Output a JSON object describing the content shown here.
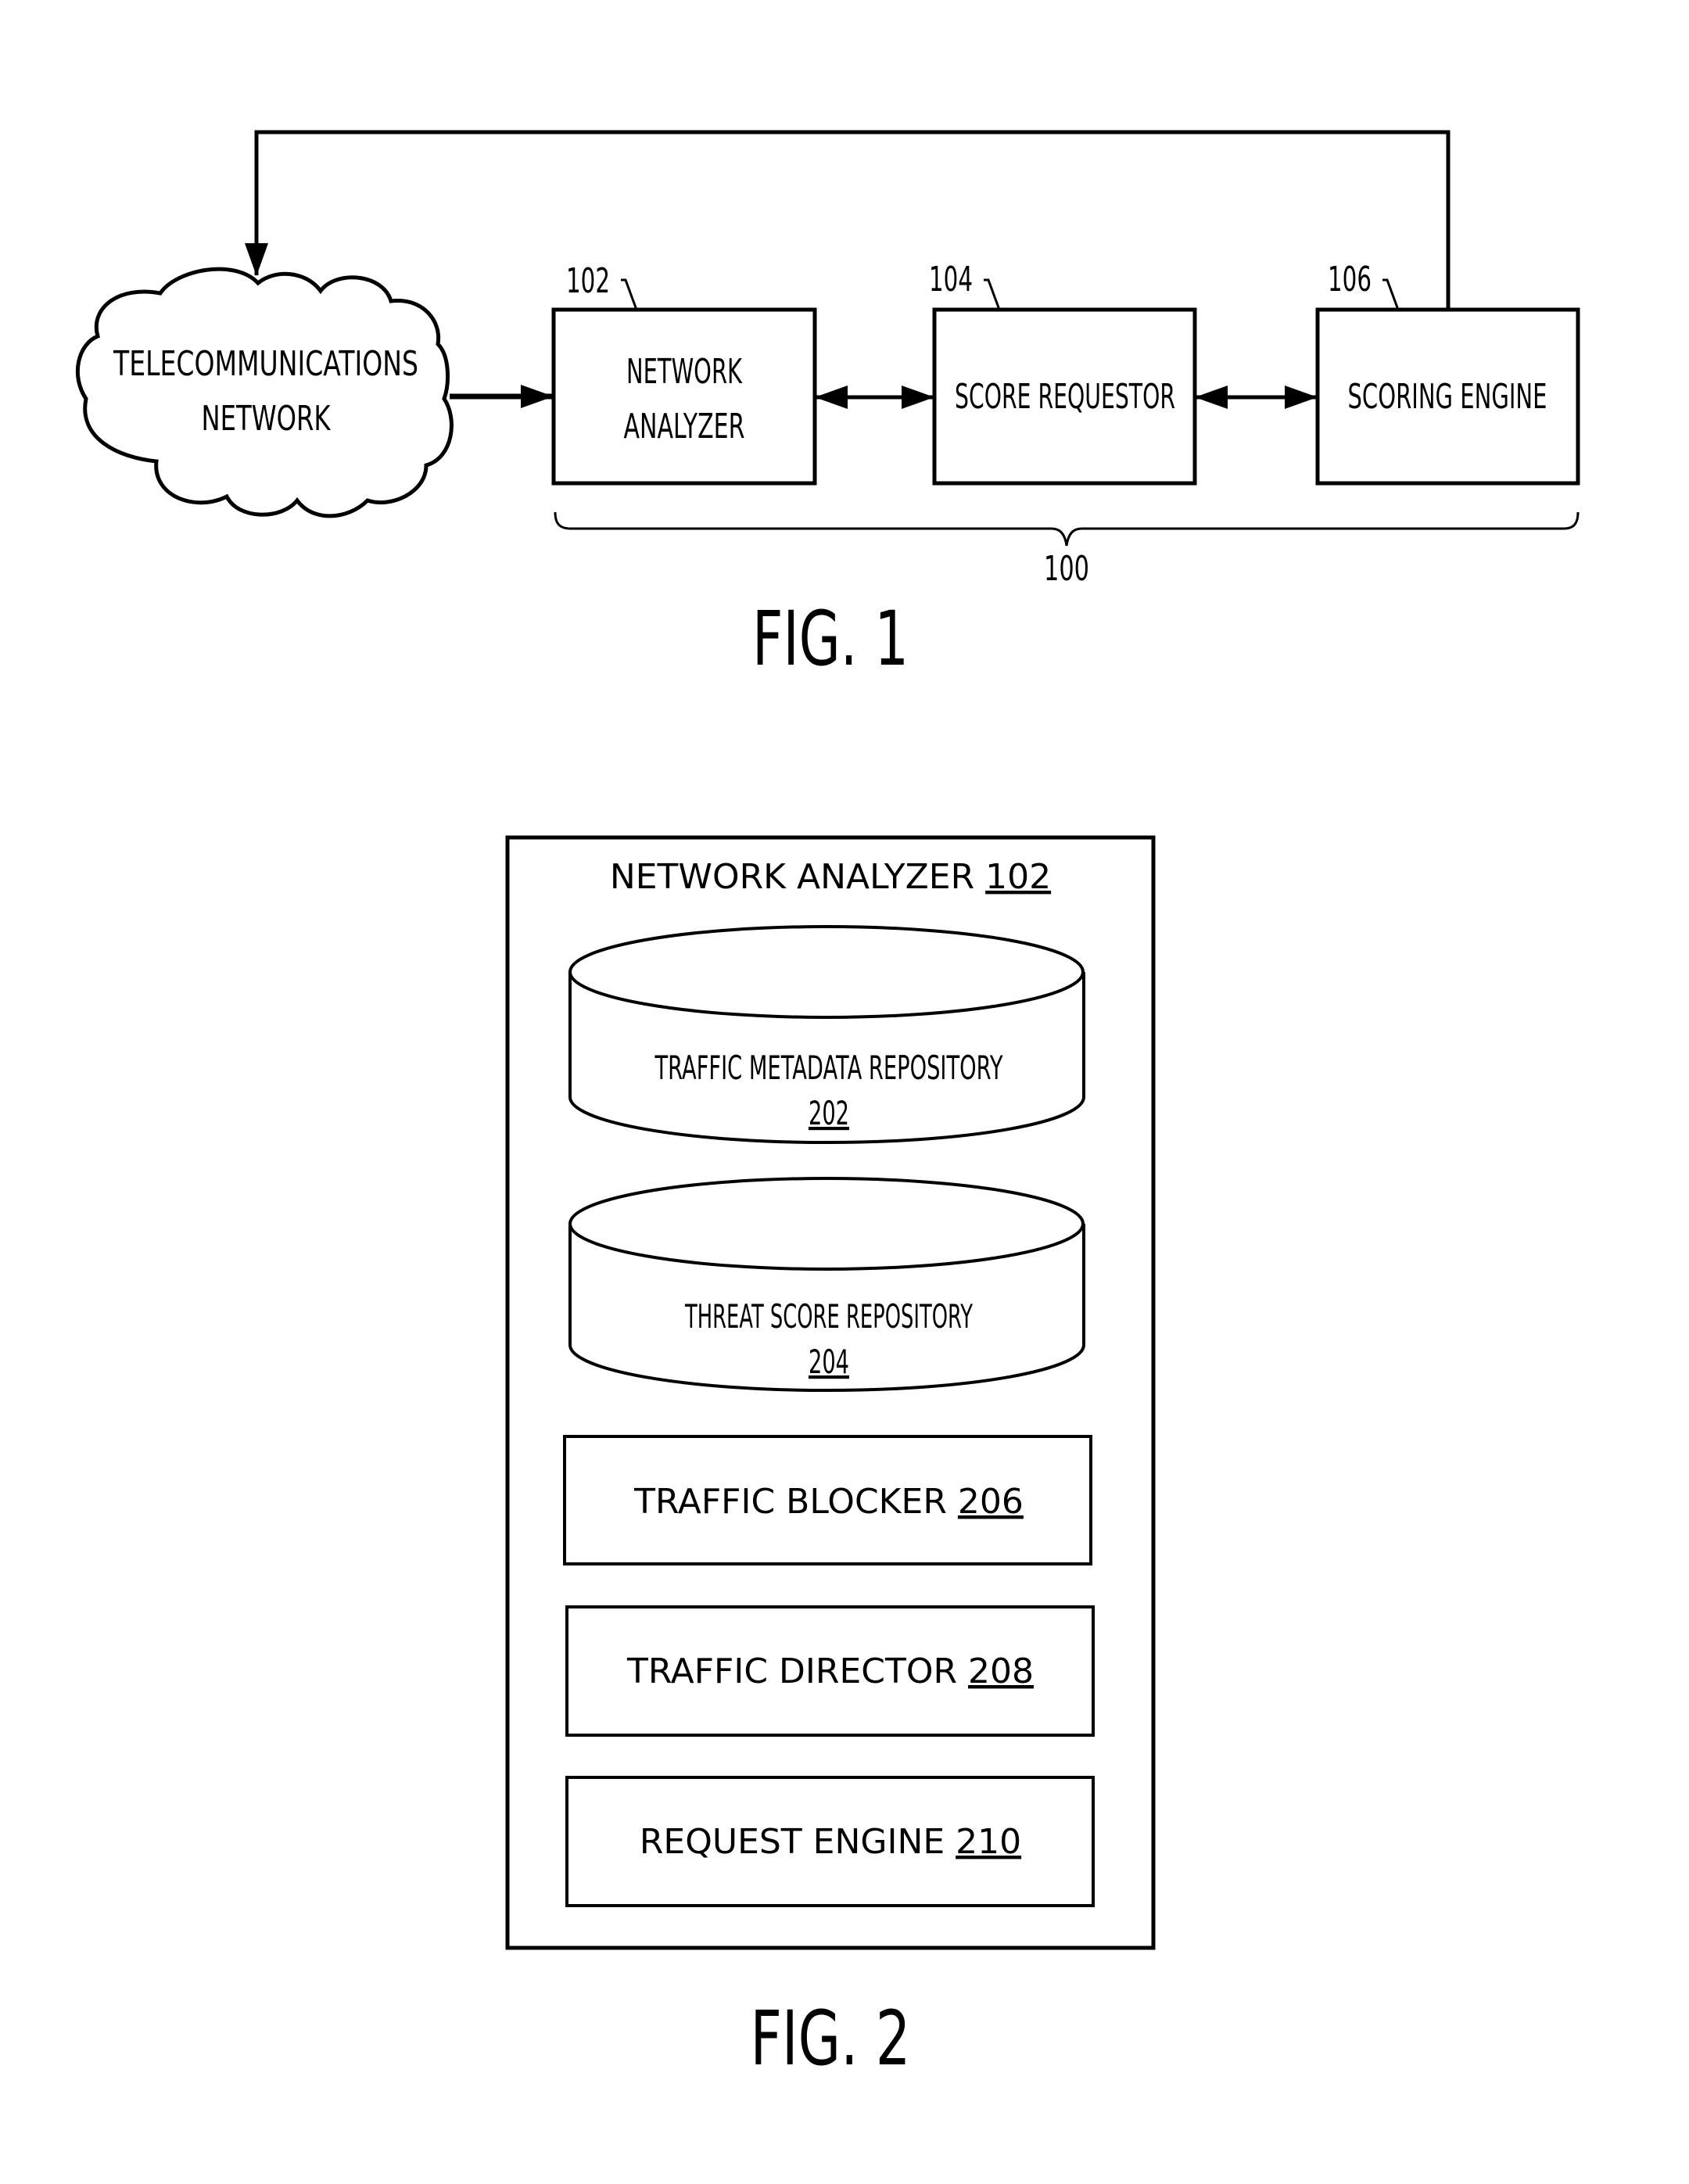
{
  "fig1": {
    "caption": "FIG. 1",
    "system_ref": "100",
    "cloud": {
      "line1": "TELECOMMUNICATIONS",
      "line2": "NETWORK"
    },
    "blocks": [
      {
        "ref": "102",
        "line1": "NETWORK",
        "line2": "ANALYZER"
      },
      {
        "ref": "104",
        "line1": "SCORE REQUESTOR",
        "line2": ""
      },
      {
        "ref": "106",
        "line1": "SCORING ENGINE",
        "line2": ""
      }
    ]
  },
  "fig2": {
    "caption": "FIG. 2",
    "container": {
      "title": "NETWORK ANALYZER ",
      "ref": "102"
    },
    "repositories": [
      {
        "name": "TRAFFIC METADATA REPOSITORY",
        "ref": "202"
      },
      {
        "name": "THREAT SCORE REPOSITORY",
        "ref": "204"
      }
    ],
    "components": [
      {
        "name": "TRAFFIC BLOCKER ",
        "ref": "206"
      },
      {
        "name": "TRAFFIC DIRECTOR ",
        "ref": "208"
      },
      {
        "name": "REQUEST ENGINE ",
        "ref": "210"
      }
    ]
  }
}
